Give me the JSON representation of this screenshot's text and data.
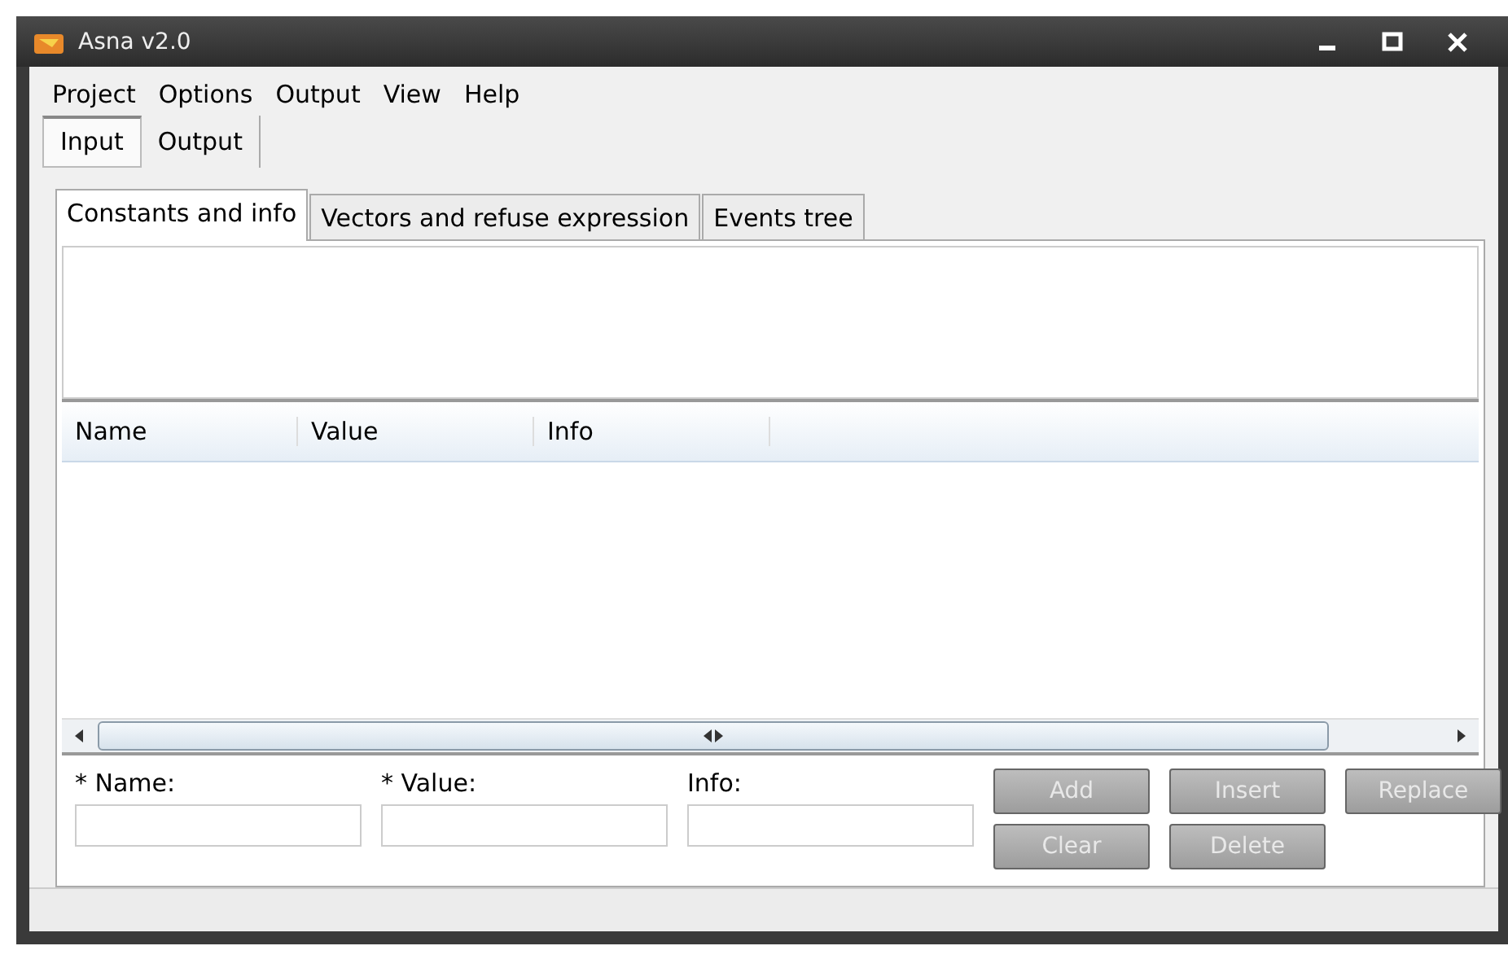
{
  "window": {
    "title": "Asna v2.0"
  },
  "menu": [
    "Project",
    "Options",
    "Output",
    "View",
    "Help"
  ],
  "main_tabs": [
    {
      "label": "Input",
      "selected": true
    },
    {
      "label": "Output",
      "selected": false
    }
  ],
  "sub_tabs": [
    {
      "label": "Constants and info",
      "selected": true
    },
    {
      "label": "Vectors and refuse expression",
      "selected": false
    },
    {
      "label": "Events tree",
      "selected": false
    }
  ],
  "table": {
    "columns": [
      "Name",
      "Value",
      "Info"
    ]
  },
  "form": {
    "fields": [
      {
        "label": "* Name:"
      },
      {
        "label": "* Value:"
      },
      {
        "label": "Info:"
      }
    ],
    "buttons": [
      {
        "label": "Add",
        "disabled": true
      },
      {
        "label": "Insert",
        "disabled": true
      },
      {
        "label": "Replace",
        "disabled": true
      },
      {
        "label": "Clear",
        "disabled": true
      },
      {
        "label": "Delete",
        "disabled": true
      }
    ]
  }
}
